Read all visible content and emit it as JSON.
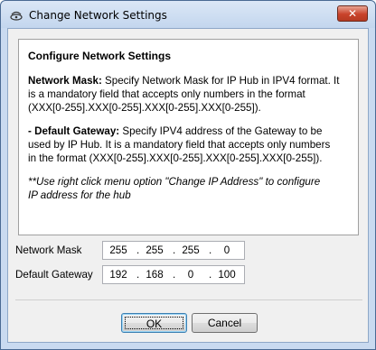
{
  "window": {
    "title": "Change Network Settings",
    "title_icon": "network-icon",
    "close_label": "✕"
  },
  "info": {
    "heading": "Configure Network Settings",
    "mask_term": "Network Mask:",
    "mask_text_1": " Specify Network Mask for IP Hub in IPV4 format. It",
    "mask_text_2": "is a mandatory field that accepts only numbers in the format",
    "mask_text_3": "(XXX[0-255].XXX[0-255].XXX[0-255].XXX[0-255]).",
    "gw_prefix": "- ",
    "gw_term": "Default Gateway:",
    "gw_text_1": " Specify IPV4 address of the Gateway to be",
    "gw_text_2": "used by IP Hub. It is a mandatory field that accepts only numbers",
    "gw_text_3": "in the format (XXX[0-255].XXX[0-255].XXX[0-255].XXX[0-255]).",
    "note_1": "**Use right click menu option \"Change IP Address\" to configure",
    "note_2": "IP address for the hub"
  },
  "fields": {
    "network_mask": {
      "label": "Network Mask",
      "octets": [
        "255",
        "255",
        "255",
        "0"
      ]
    },
    "default_gateway": {
      "label": "Default Gateway",
      "octets": [
        "192",
        "168",
        "0",
        "100"
      ]
    },
    "separator": "."
  },
  "buttons": {
    "ok_label": "OK",
    "cancel_label": "Cancel"
  }
}
